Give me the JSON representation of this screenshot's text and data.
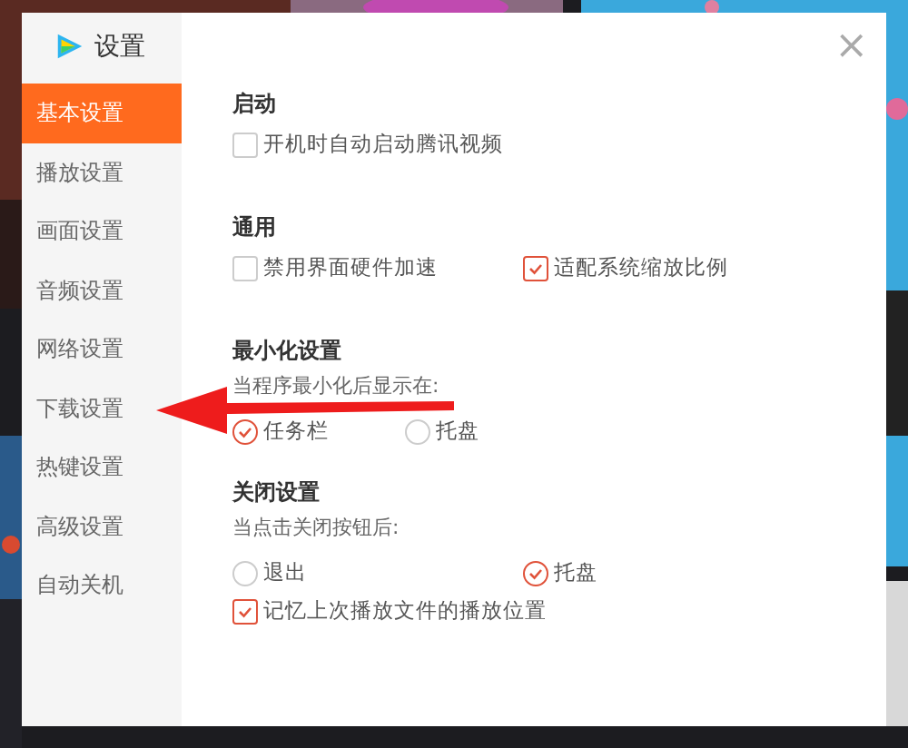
{
  "dialog": {
    "title": "设置"
  },
  "sidebar": {
    "items": [
      {
        "label": "基本设置",
        "selected": true
      },
      {
        "label": "播放设置",
        "selected": false
      },
      {
        "label": "画面设置",
        "selected": false
      },
      {
        "label": "音频设置",
        "selected": false
      },
      {
        "label": "网络设置",
        "selected": false
      },
      {
        "label": "下载设置",
        "selected": false
      },
      {
        "label": "热键设置",
        "selected": false
      },
      {
        "label": "高级设置",
        "selected": false
      },
      {
        "label": "自动关机",
        "selected": false
      }
    ]
  },
  "sections": [
    {
      "title": "启动",
      "rows": [
        [
          {
            "kind": "checkbox",
            "label": "开机时自动启动腾讯视频",
            "checked": false
          }
        ]
      ]
    },
    {
      "title": "通用",
      "rows": [
        [
          {
            "kind": "checkbox",
            "label": "禁用界面硬件加速",
            "checked": false
          },
          {
            "kind": "checkbox",
            "label": "适配系统缩放比例",
            "checked": true
          }
        ]
      ]
    },
    {
      "title": "最小化设置",
      "subtitle": "当程序最小化后显示在:",
      "rows": [
        [
          {
            "kind": "radio",
            "label": "任务栏",
            "selected": true
          },
          {
            "kind": "radio",
            "label": "托盘",
            "selected": false
          }
        ]
      ]
    },
    {
      "title": "关闭设置",
      "subtitle": "当点击关闭按钮后:",
      "rows": [
        [
          {
            "kind": "radio",
            "label": "退出",
            "selected": false
          },
          {
            "kind": "radio",
            "label": "托盘",
            "selected": true
          }
        ],
        [
          {
            "kind": "checkbox",
            "label": "记忆上次播放文件的播放位置",
            "checked": true
          }
        ]
      ]
    }
  ],
  "close_button": "×"
}
